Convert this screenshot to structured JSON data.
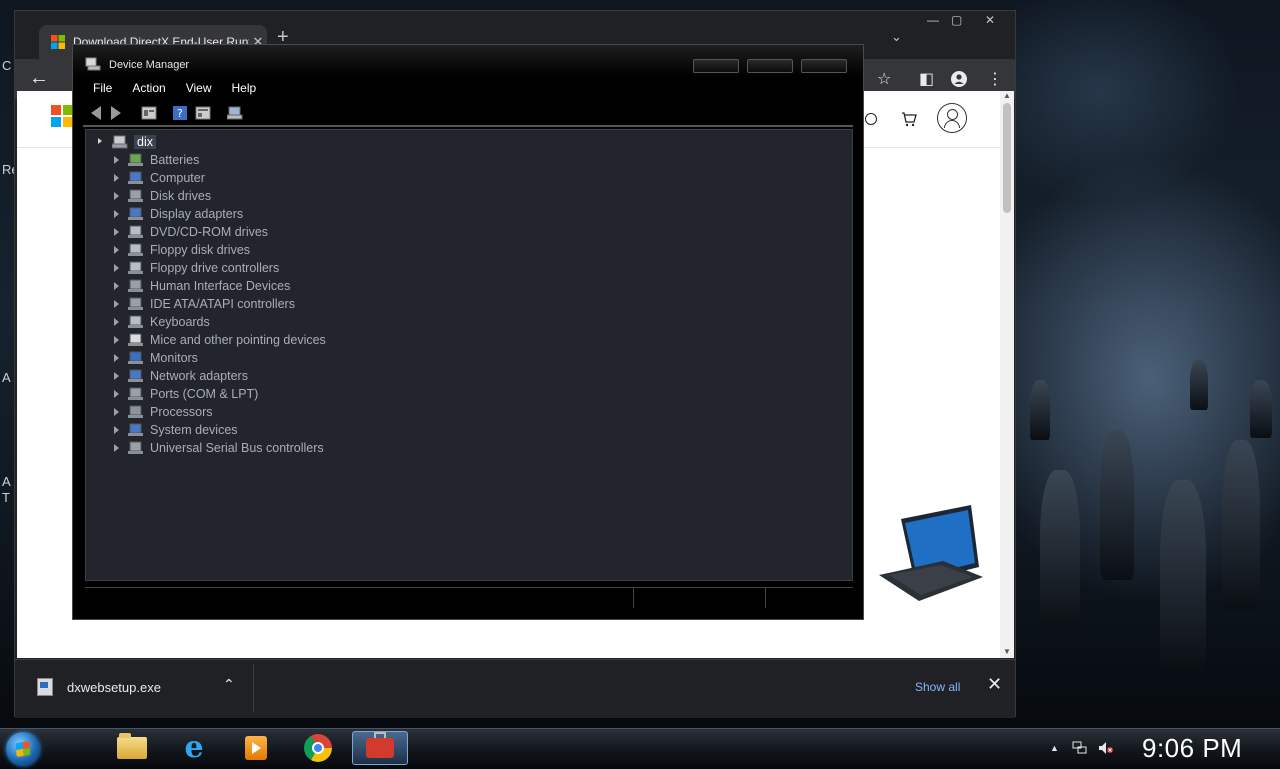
{
  "desktop": {
    "fragments": [
      "C",
      "Re",
      "A",
      "A",
      "T"
    ]
  },
  "browser": {
    "tab_title": "Download DirectX End-User Runt",
    "tab_close": "✕",
    "new_tab": "+",
    "tab_search": "⌄",
    "window_controls": {
      "minimize": "—",
      "maximize": "▢",
      "close": "✕"
    },
    "nav_back": "←",
    "toolbar_icons": {
      "star": "☆",
      "sidepanel": "◧",
      "menu": "⋮"
    },
    "download": {
      "file_name": "dxwebsetup.exe",
      "chevron": "⌃",
      "show_all": "Show all",
      "close": "✕"
    }
  },
  "device_manager": {
    "title": "Device Manager",
    "menu": [
      "File",
      "Action",
      "View",
      "Help"
    ],
    "root": "dix",
    "devices": [
      "Batteries",
      "Computer",
      "Disk drives",
      "Display adapters",
      "DVD/CD-ROM drives",
      "Floppy disk drives",
      "Floppy drive controllers",
      "Human Interface Devices",
      "IDE ATA/ATAPI controllers",
      "Keyboards",
      "Mice and other pointing devices",
      "Monitors",
      "Network adapters",
      "Ports (COM & LPT)",
      "Processors",
      "System devices",
      "Universal Serial Bus controllers"
    ]
  },
  "taskbar": {
    "clock": "9:06 PM",
    "pinned": [
      "folder-icon",
      "internet-explorer-icon",
      "media-player-icon",
      "chrome-icon",
      "toolbox-icon"
    ]
  },
  "colors": {
    "chrome_frame": "#202124",
    "dm_background": "#22252b",
    "dm_text": "#a9aeb6",
    "link_blue": "#8ab4f8"
  }
}
